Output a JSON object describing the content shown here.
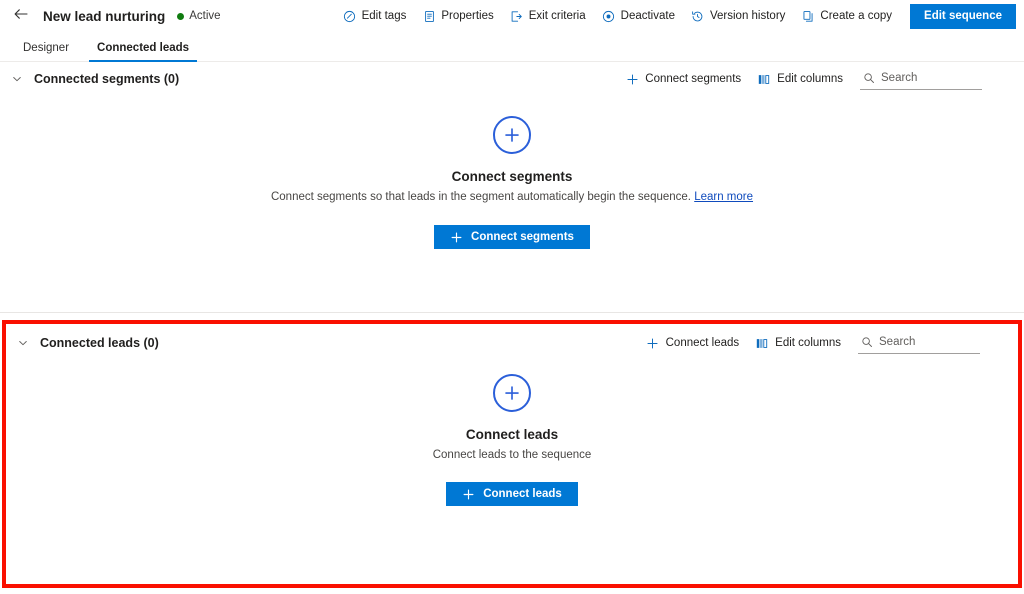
{
  "header": {
    "back_icon": "arrow-left-icon",
    "title": "New lead nurturing",
    "status": "Active",
    "status_color": "#107c10",
    "accent_color": "#0078d4",
    "commands": [
      {
        "label": "Edit tags",
        "icon": "tag-icon"
      },
      {
        "label": "Properties",
        "icon": "document-properties-icon"
      },
      {
        "label": "Exit criteria",
        "icon": "exit-icon"
      },
      {
        "label": "Deactivate",
        "icon": "circle-target-icon"
      },
      {
        "label": "Version history",
        "icon": "history-clock-icon"
      },
      {
        "label": "Create a copy",
        "icon": "copy-icon"
      }
    ],
    "primary_button": "Edit sequence"
  },
  "tabs": [
    {
      "label": "Designer",
      "active": false
    },
    {
      "label": "Connected leads",
      "active": true
    }
  ],
  "segments_section": {
    "chevron_icon": "chevron-down-icon",
    "title": "Connected segments (0)",
    "actions": [
      {
        "label": "Connect segments",
        "icon": "plus-icon"
      },
      {
        "label": "Edit columns",
        "icon": "edit-columns-icon"
      }
    ],
    "search_placeholder": "Search",
    "search_value": "",
    "search_icon": "search-icon",
    "empty": {
      "circle_icon": "plus-circle-icon",
      "title": "Connect segments",
      "description": "Connect segments so that leads in the segment automatically begin the sequence.",
      "link": "Learn more",
      "cta": "Connect segments"
    }
  },
  "leads_section": {
    "highlight_color": "#fa0f00",
    "chevron_icon": "chevron-down-icon",
    "title": "Connected leads (0)",
    "actions": [
      {
        "label": "Connect leads",
        "icon": "plus-icon"
      },
      {
        "label": "Edit columns",
        "icon": "edit-columns-icon"
      }
    ],
    "search_placeholder": "Search",
    "search_value": "",
    "search_icon": "search-icon",
    "empty": {
      "circle_icon": "plus-circle-icon",
      "title": "Connect leads",
      "description": "Connect leads to the sequence",
      "cta": "Connect leads"
    }
  }
}
